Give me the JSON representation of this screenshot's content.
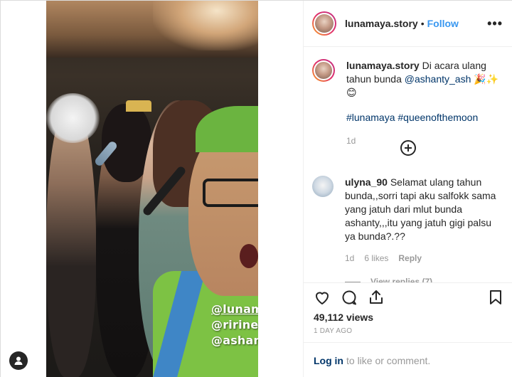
{
  "header": {
    "username": "lunamaya.story",
    "dot": "•",
    "follow_label": "Follow",
    "more_icon": "more-options-icon"
  },
  "media": {
    "stickers": [
      "@lunamaya",
      "@ririnekawati",
      "@ashanty_ash"
    ]
  },
  "caption": {
    "username": "lunamaya.story",
    "text_before": "Di acara ulang tahun bunda ",
    "mention": "@ashanty_ash",
    "emoji": "🎉✨😊",
    "hashtags": "#lunamaya #queenofthemoon",
    "time": "1d"
  },
  "comment": {
    "username": "ulyna_90",
    "text": "Selamat ulang tahun bunda,,sorri tapi aku salfokk sama yang jatuh dari mlut bunda ashanty,,,itu yang jatuh gigi palsu ya bunda?.??",
    "time": "1d",
    "likes": "6 likes",
    "reply": "Reply",
    "view_replies": "View replies (7)"
  },
  "stats": {
    "views": "49,112 views",
    "date": "1 DAY AGO"
  },
  "footer": {
    "login_link": "Log in",
    "login_text": "to like or comment."
  }
}
